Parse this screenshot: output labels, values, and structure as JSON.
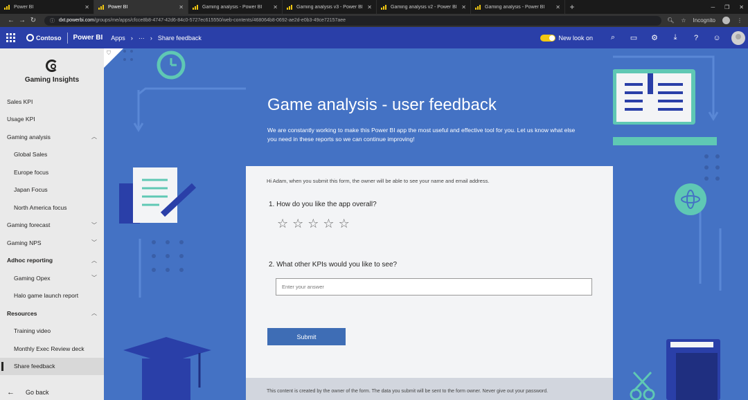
{
  "browser": {
    "tabs": [
      {
        "title": "Power BI",
        "active": false
      },
      {
        "title": "Power BI",
        "active": true
      },
      {
        "title": "Gaming analysis - Power BI",
        "active": false
      },
      {
        "title": "Gaming analysis v3 - Power BI",
        "active": false
      },
      {
        "title": "Gaming analysis v2 - Power BI",
        "active": false
      },
      {
        "title": "Gaming analysis - Power BI",
        "active": false
      }
    ],
    "url_host": "dxt.powerbi.com",
    "url_path": "/groups/me/apps/cfcce8b8-4747-42d6-84c0-5727ec615550/web-contents/468064b8-0692-ae2d-e0b3-49ce72157aee",
    "incognito_label": "Incognito"
  },
  "header": {
    "org": "Contoso",
    "product": "Power BI",
    "breadcrumb": [
      "Apps",
      "···",
      "Share feedback"
    ],
    "new_look_label": "New look on"
  },
  "app": {
    "title": "Gaming Insights",
    "back_label": "Go back"
  },
  "nav": [
    {
      "label": "Sales KPI",
      "level": 0
    },
    {
      "label": "Usage KPI",
      "level": 0
    },
    {
      "label": "Gaming analysis",
      "level": 0,
      "chevron": "up"
    },
    {
      "label": "Global Sales",
      "level": 1
    },
    {
      "label": "Europe focus",
      "level": 1
    },
    {
      "label": "Japan Focus",
      "level": 1
    },
    {
      "label": "North America focus",
      "level": 1
    },
    {
      "label": "Gaming forecast",
      "level": 0,
      "chevron": "down"
    },
    {
      "label": "Gaming NPS",
      "level": 0,
      "chevron": "down"
    },
    {
      "label": "Adhoc reporting",
      "level": 0,
      "chevron": "up",
      "bold": true
    },
    {
      "label": "Gaming Opex",
      "level": 1,
      "chevron": "down"
    },
    {
      "label": "Halo game launch report",
      "level": 1
    },
    {
      "label": "Resources",
      "level": 0,
      "chevron": "up",
      "bold": true
    },
    {
      "label": "Training video",
      "level": 1
    },
    {
      "label": "Monthly Exec Review deck",
      "level": 1
    },
    {
      "label": "Share feedback",
      "level": 1,
      "selected": true
    }
  ],
  "form": {
    "title": "Game analysis - user feedback",
    "description": "We are constantly working to make this Power BI app the most useful and effective tool for you. Let us know what else you need in these reports so we can continue improving!",
    "notice": "Hi Adam, when you submit this form, the owner will be able to see your name and email address.",
    "q1": "1. How do you like the app overall?",
    "rating": {
      "value": 0,
      "max": 5
    },
    "q2": "2. What other KPIs would you like to see?",
    "answer_value": "",
    "answer_placeholder": "Enter your answer",
    "submit_label": "Submit",
    "footer": "This content is created by the owner of the form. The data you submit will be sent to the form owner. Never give out your password."
  },
  "colors": {
    "header_bg": "#2a3fa8",
    "content_bg": "#4472c4",
    "accent_toggle": "#f2c811",
    "submit_bg": "#3e6db5",
    "teal": "#5fc8b4"
  }
}
